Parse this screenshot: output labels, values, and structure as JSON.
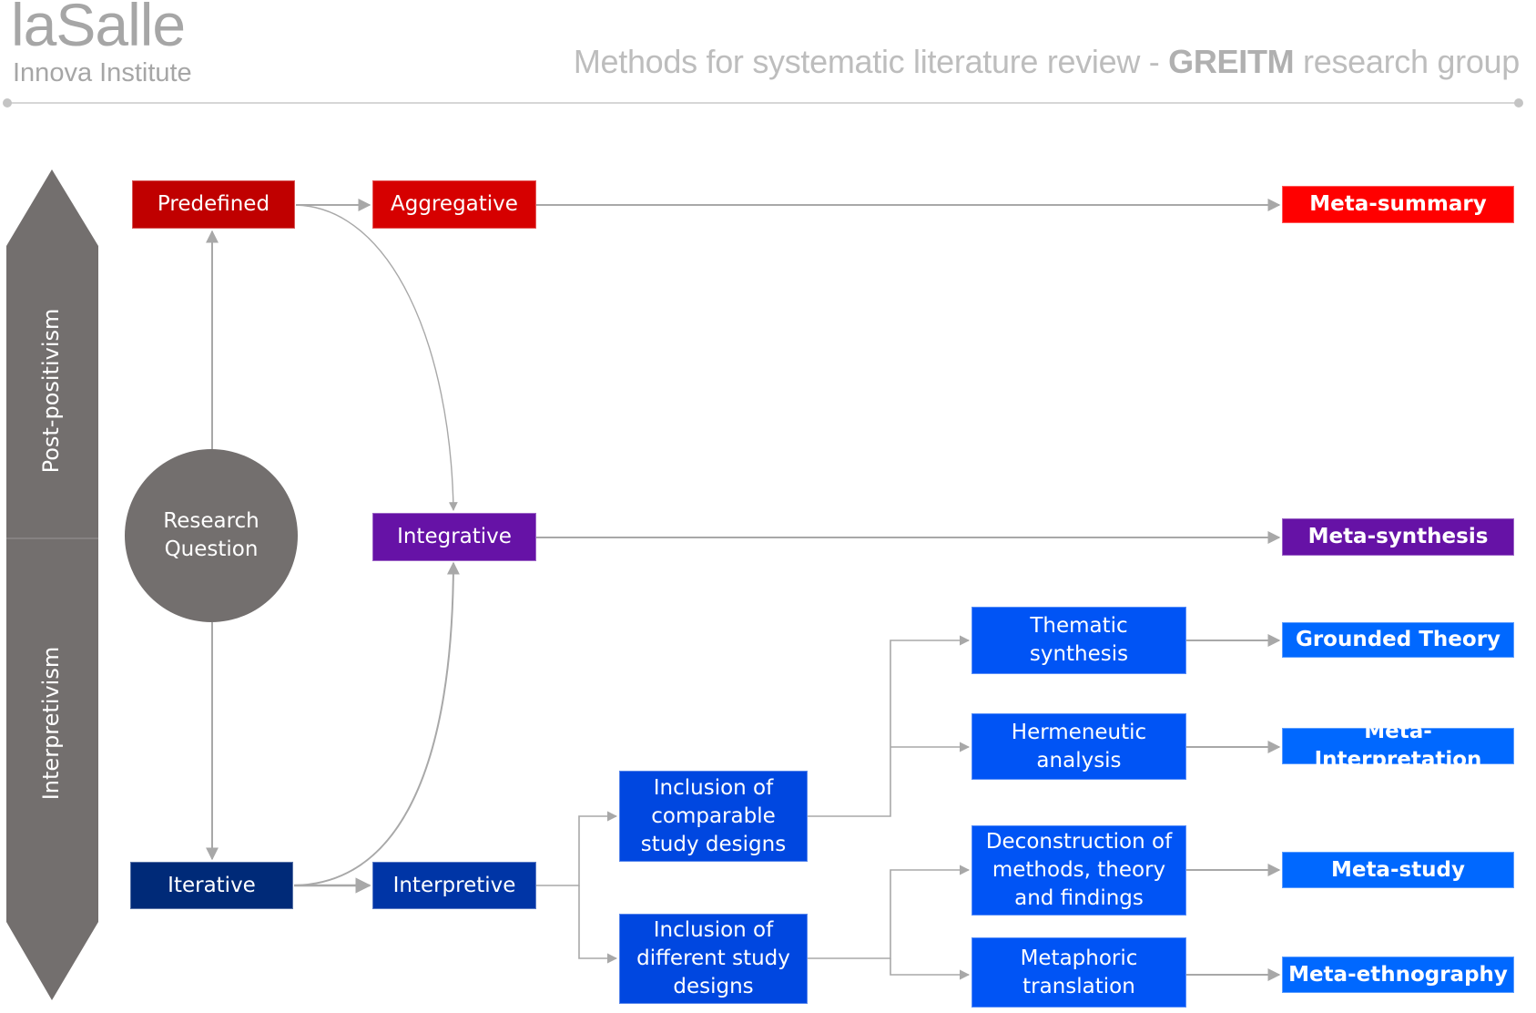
{
  "header": {
    "logo_main": "laSalle",
    "logo_sub": "Innova Institute",
    "title_prefix": "Methods for systematic literature review - ",
    "title_bold": "GREITM",
    "title_suffix": " research group"
  },
  "side_axis": {
    "top_label": "Post-positivism",
    "bottom_label": "Interpretivism"
  },
  "colors": {
    "gray": "#736f6e",
    "dark_red": "#c00000",
    "red": "#d60000",
    "bright_red": "#ff0000",
    "purple": "#6612a6",
    "navy": "#002a78",
    "dark_blue": "#0035a6",
    "blue": "#0047e0",
    "mid_blue": "#0054f5",
    "light_blue": "#0068ff",
    "connector": "#a8a8a8"
  },
  "nodes": {
    "research_question": "Research\nQuestion",
    "predefined": "Predefined",
    "iterative": "Iterative",
    "aggregative": "Aggregative",
    "integrative": "Integrative",
    "interpretive": "Interpretive",
    "inclusion_comparable": "Inclusion of\ncomparable\nstudy designs",
    "inclusion_different": "Inclusion of\ndifferent study\ndesigns",
    "thematic": "Thematic\nsynthesis",
    "hermeneutic": "Hermeneutic\nanalysis",
    "deconstruction": "Deconstruction of\nmethods, theory\nand findings",
    "metaphoric": "Metaphoric\ntranslation"
  },
  "outcomes": {
    "meta_summary": "Meta-summary",
    "meta_synthesis": "Meta-synthesis",
    "grounded_theory": "Grounded Theory",
    "meta_interpretation": "Meta-Interpretation",
    "meta_study": "Meta-study",
    "meta_ethnography": "Meta-ethnography"
  }
}
